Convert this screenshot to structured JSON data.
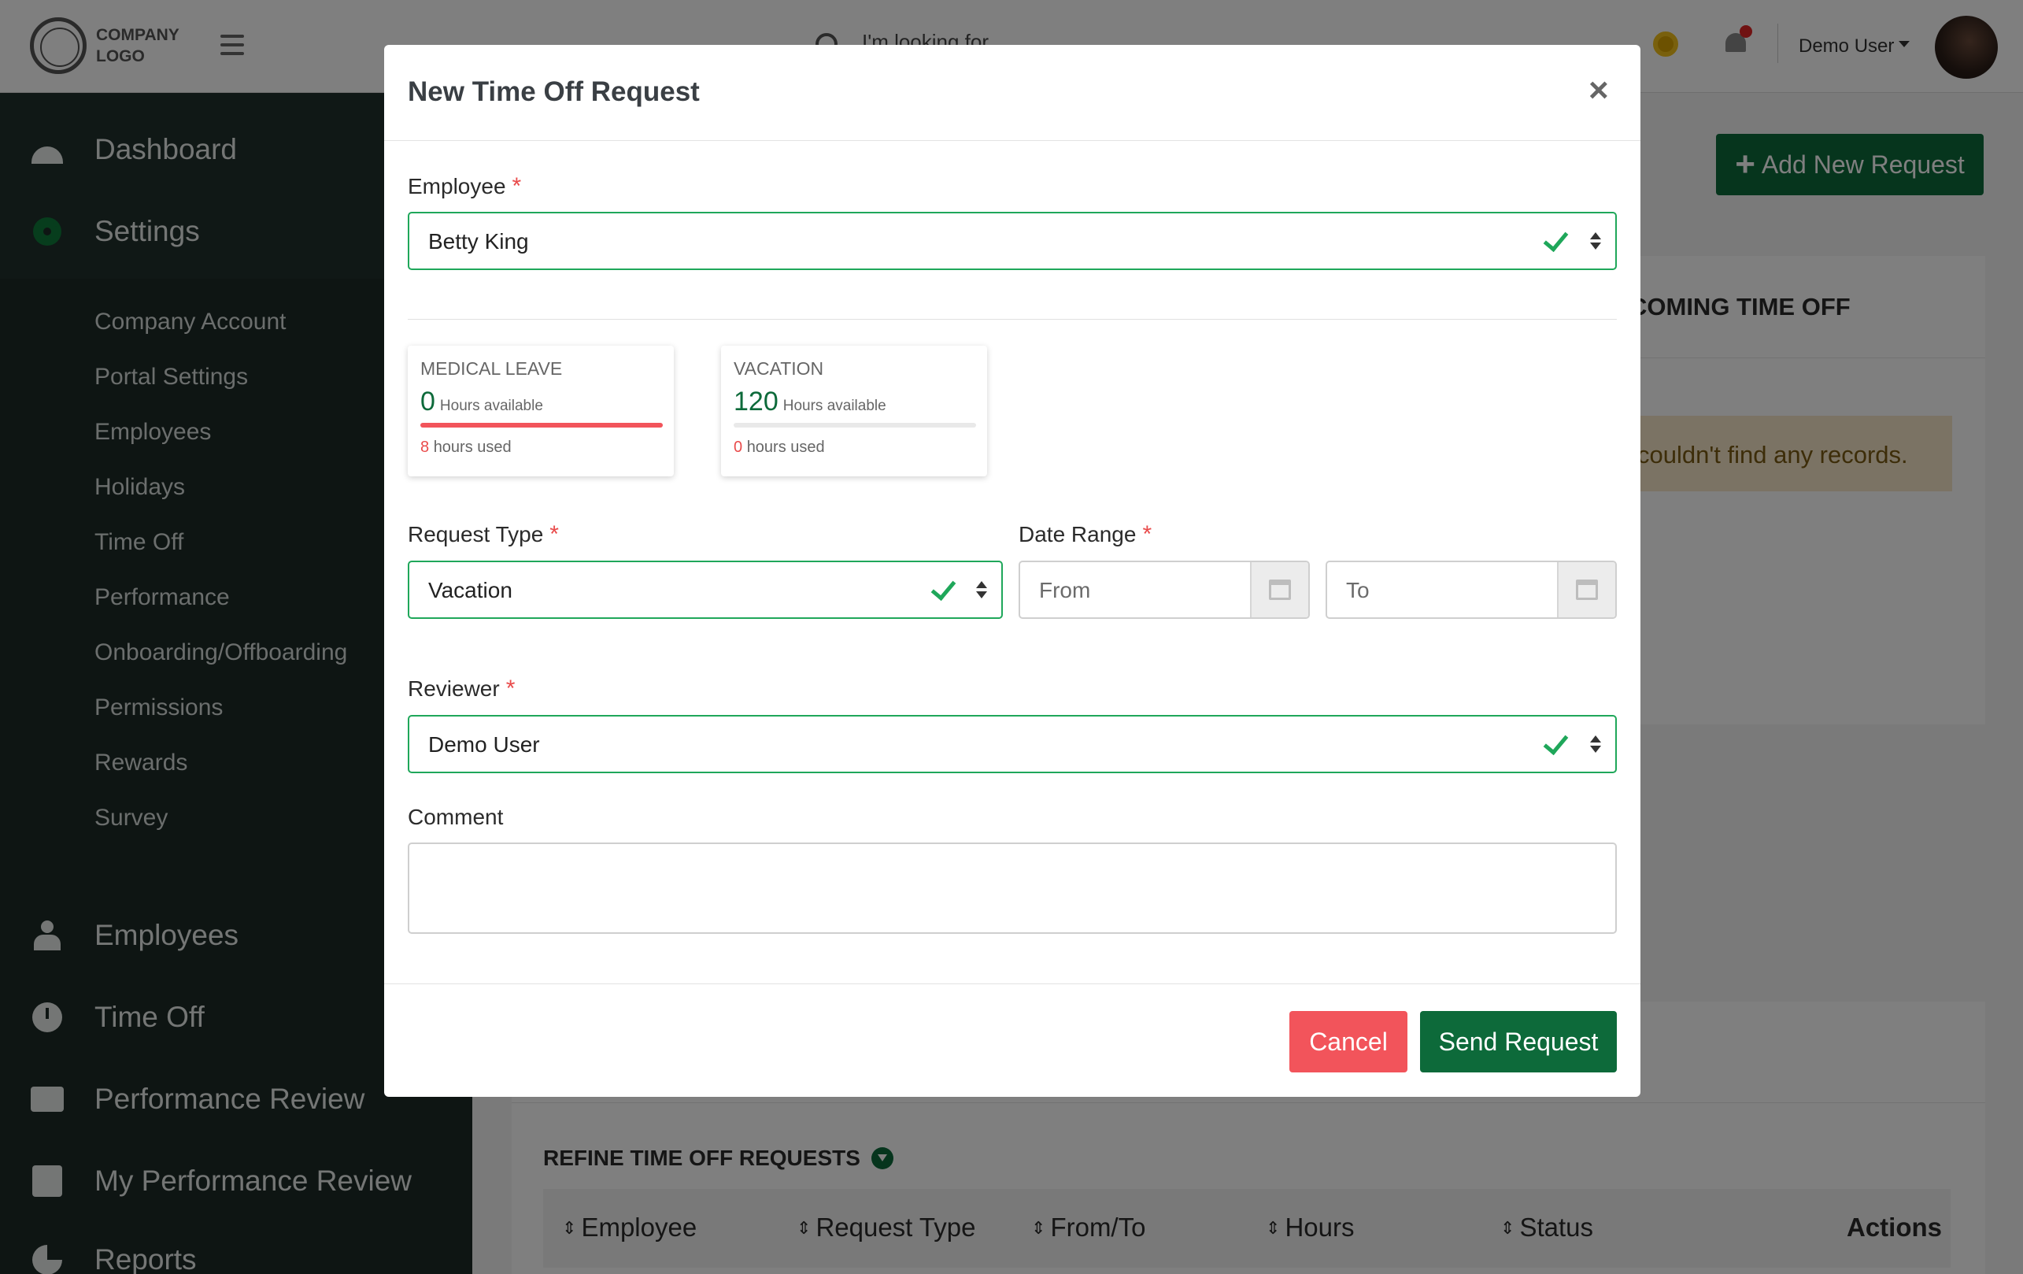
{
  "header": {
    "logo_line1": "COMPANY",
    "logo_line2": "LOGO",
    "search_placeholder": "I'm looking for...",
    "user_name": "Demo User"
  },
  "sidebar": {
    "main_items": [
      {
        "label": "Dashboard",
        "icon": "dashboard-icon"
      },
      {
        "label": "Settings",
        "icon": "gear-icon"
      }
    ],
    "settings_items": [
      "Company Account",
      "Portal Settings",
      "Employees",
      "Holidays",
      "Time Off",
      "Performance",
      "Onboarding/Offboarding",
      "Permissions",
      "Rewards",
      "Survey"
    ],
    "bottom_items": [
      {
        "label": "Employees",
        "icon": "person-icon"
      },
      {
        "label": "Time Off",
        "icon": "clock-icon"
      },
      {
        "label": "Performance Review",
        "icon": "id-card-icon"
      },
      {
        "label": "My Performance Review",
        "icon": "badge-icon"
      },
      {
        "label": "Reports",
        "icon": "pie-chart-icon"
      }
    ]
  },
  "page": {
    "add_button": "Add New Request",
    "upcoming_title": "COMING TIME OFF",
    "no_records": "couldn't find any records.",
    "refine_title": "REFINE TIME OFF REQUESTS",
    "table_headers": [
      "Employee",
      "Request Type",
      "From/To",
      "Hours",
      "Status",
      "Actions"
    ]
  },
  "modal": {
    "title": "New Time Off Request",
    "employee_label": "Employee",
    "employee_value": "Betty King",
    "balances": [
      {
        "title": "MEDICAL LEAVE",
        "hours": "0",
        "hours_label": "Hours available",
        "used": "8",
        "used_label": "hours used",
        "used_fraction": 1.0
      },
      {
        "title": "VACATION",
        "hours": "120",
        "hours_label": "Hours available",
        "used": "0",
        "used_label": "hours used",
        "used_fraction": 0.0
      }
    ],
    "request_type_label": "Request Type",
    "request_type_value": "Vacation",
    "date_range_label": "Date Range",
    "from_placeholder": "From",
    "to_placeholder": "To",
    "reviewer_label": "Reviewer",
    "reviewer_value": "Demo User",
    "comment_label": "Comment",
    "cancel_label": "Cancel",
    "send_label": "Send Request",
    "colors": {
      "success": "#1fa75a",
      "brand": "#0d6a3a",
      "danger": "#f2545b"
    }
  }
}
